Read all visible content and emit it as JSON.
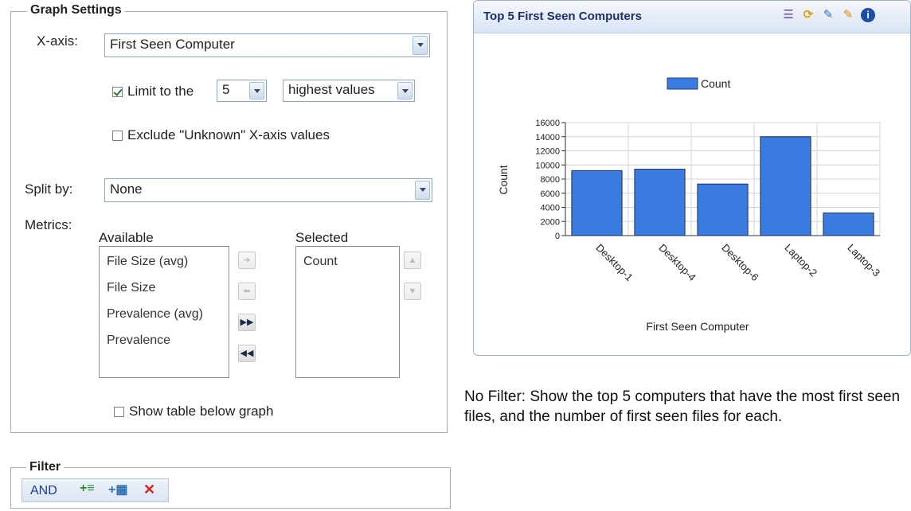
{
  "graph_settings": {
    "legend": "Graph Settings",
    "x_axis": {
      "label": "X-axis:",
      "value": "First Seen Computer"
    },
    "limit": {
      "checked": true,
      "label": "Limit to the",
      "count": "5",
      "mode": "highest values"
    },
    "exclude_unknown": {
      "checked": false,
      "label": "Exclude \"Unknown\" X-axis values"
    },
    "split_by": {
      "label": "Split by:",
      "value": "None"
    },
    "metrics": {
      "label": "Metrics:",
      "available_label": "Available",
      "available": [
        "File Size (avg)",
        "File Size",
        "Prevalence (avg)",
        "Prevalence"
      ],
      "selected_label": "Selected",
      "selected": [
        "Count"
      ],
      "move_buttons": [
        "arrow-right-icon",
        "arrow-left-icon",
        "double-right-icon",
        "double-left-icon"
      ],
      "order_buttons": [
        "move-up-icon",
        "move-down-icon"
      ]
    },
    "show_table": {
      "checked": false,
      "label": "Show table below graph"
    }
  },
  "filter": {
    "legend": "Filter",
    "and_label": "AND",
    "icons": [
      "add-condition-icon",
      "add-group-icon",
      "delete-icon"
    ]
  },
  "panel": {
    "title": "Top 5 First Seen Computers",
    "toolbar_icons": [
      "stack-icon",
      "refresh-icon",
      "edit-wand-icon",
      "notes-icon",
      "info-icon"
    ]
  },
  "chart_data": {
    "type": "bar",
    "categories": [
      "Desktop-1",
      "Desktop-4",
      "Desktop-6",
      "Laptop-2",
      "Laptop-3"
    ],
    "series": [
      {
        "name": "Count",
        "values": [
          9200,
          9400,
          7300,
          14000,
          3200
        ]
      }
    ],
    "xlabel": "First Seen Computer",
    "ylabel": "Count",
    "ylim": [
      0,
      16000
    ],
    "yticks": [
      0,
      2000,
      4000,
      6000,
      8000,
      10000,
      12000,
      14000,
      16000
    ],
    "legend_position": "top-center",
    "grid": true,
    "bar_color": "#3a7be0"
  },
  "description": "No Filter: Show the top 5 computers that have the most  first seen files, and the number of first seen files for  each."
}
